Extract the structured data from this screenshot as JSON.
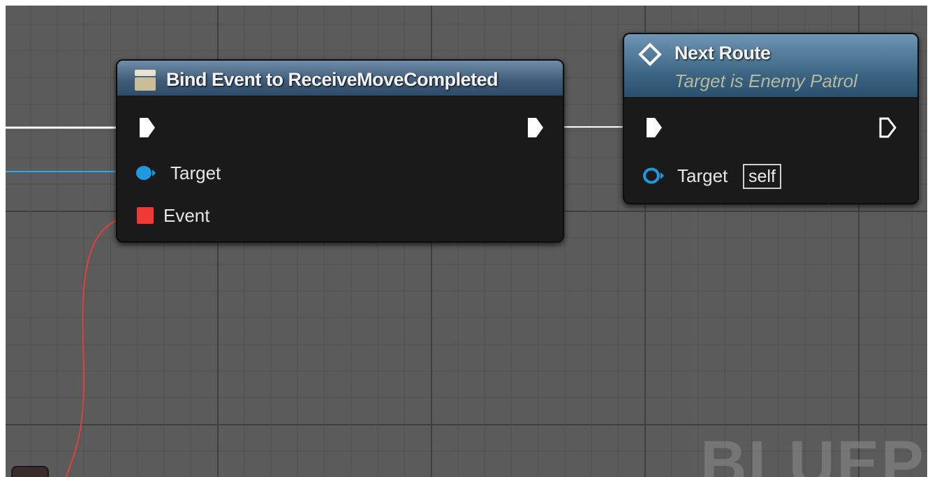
{
  "bind_node": {
    "title": "Bind Event to ReceiveMoveCompleted",
    "pins": {
      "target_label": "Target",
      "event_label": "Event"
    }
  },
  "route_node": {
    "title": "Next Route",
    "subtitle": "Target is Enemy Patrol",
    "pins": {
      "target_label": "Target",
      "target_default": "self"
    }
  },
  "watermark": "BLUEPR",
  "colors": {
    "exec_wire": "#ffffff",
    "object_wire": "#2fa7e6",
    "delegate_wire": "#e0413b",
    "object_pin": "#1e9be0",
    "delegate_pin": "#f03a35",
    "graph_background": "#5b5b5b"
  },
  "icons": {
    "bind_node_icon": "event-dispatcher-icon",
    "route_node_icon": "function-icon"
  }
}
